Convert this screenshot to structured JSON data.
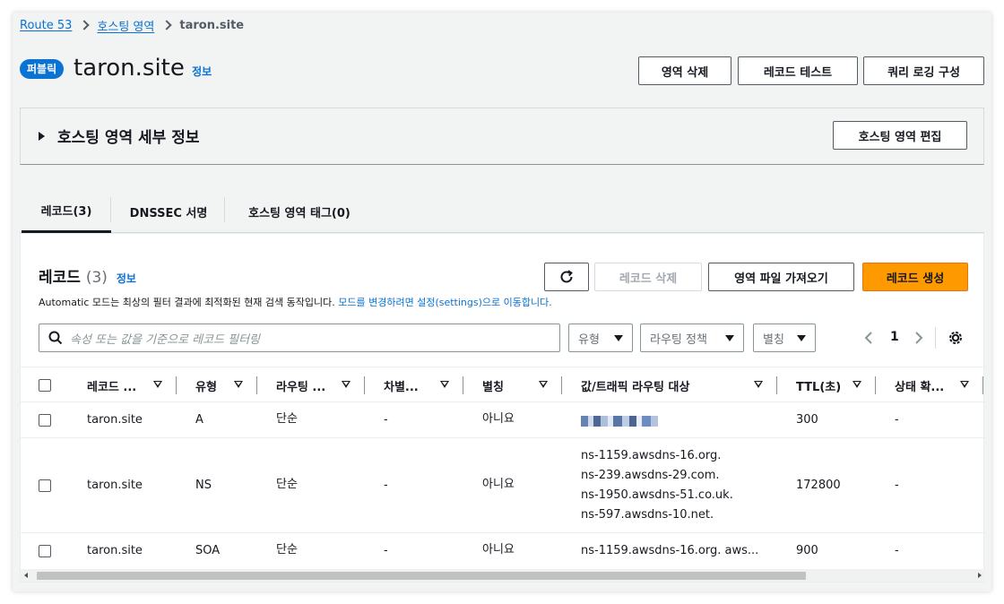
{
  "breadcrumb": {
    "root": "Route 53",
    "parent": "호스팅 영역",
    "current": "taron.site"
  },
  "header": {
    "badge": "퍼블릭",
    "title": "taron.site",
    "info": "정보",
    "btn_delete_zone": "영역 삭제",
    "btn_test_record": "레코드 테스트",
    "btn_query_logging": "쿼리 로깅 구성"
  },
  "details_panel": {
    "title": "호스팅 영역 세부 정보",
    "edit_button": "호스팅 영역 편집"
  },
  "tabs": [
    {
      "label": "레코드(3)"
    },
    {
      "label": "DNSSEC 서명"
    },
    {
      "label": "호스팅 영역 태그(0)"
    }
  ],
  "records": {
    "title": "레코드",
    "count": "(3)",
    "info": "정보",
    "note_text": "Automatic 모드는 최상의 필터 결과에 최적화된 현재 검색 동작입니다. ",
    "note_link": "모드를 변경하려면 설정(settings)으로 이동합니다.",
    "btn_delete": "레코드 삭제",
    "btn_import": "영역 파일 가져오기",
    "btn_create": "레코드 생성",
    "search_placeholder": "속성 또는 값을 기준으로 레코드 필터링",
    "filter_type": "유형",
    "filter_routing": "라우팅 정책",
    "filter_alias": "별칭",
    "page": "1",
    "columns": [
      "레코드 ...",
      "유형",
      "라우팅 ...",
      "차별...",
      "별칭",
      "값/트래픽 라우팅 대상",
      "TTL(초)",
      "상태 확..."
    ],
    "rows": [
      {
        "name": "taron.site",
        "type": "A",
        "routing": "단순",
        "diff": "-",
        "alias": "아니요",
        "values": [],
        "ttl": "300",
        "health": "-"
      },
      {
        "name": "taron.site",
        "type": "NS",
        "routing": "단순",
        "diff": "-",
        "alias": "아니요",
        "values": [
          "ns-1159.awsdns-16.org.",
          "ns-239.awsdns-29.com.",
          "ns-1950.awsdns-51.co.uk.",
          "ns-597.awsdns-10.net."
        ],
        "ttl": "172800",
        "health": "-"
      },
      {
        "name": "taron.site",
        "type": "SOA",
        "routing": "단순",
        "diff": "-",
        "alias": "아니요",
        "values": [
          "ns-1159.awsdns-16.org. aws..."
        ],
        "ttl": "900",
        "health": "-"
      }
    ]
  },
  "colors": {
    "link": "#0972d3",
    "primary": "#ff9900",
    "text": "#16191f"
  }
}
